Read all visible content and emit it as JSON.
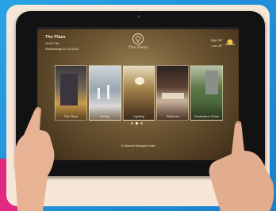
{
  "header": {
    "title": "The Plaza",
    "time": "10:00 PM",
    "date": "Wednesday 01.10.2010",
    "brand": "The Plaza",
    "weather": {
      "high_label": "High",
      "high_value": "30°",
      "low_label": "Low",
      "low_value": "28°",
      "icon": "sun-icon"
    }
  },
  "tiles": [
    {
      "label": "The Plaza"
    },
    {
      "label": "Dining"
    },
    {
      "label": "Lighting"
    },
    {
      "label": "Wellness"
    },
    {
      "label": "Destination Guide"
    }
  ],
  "pagination": {
    "count": 3,
    "active": 1
  },
  "footer": {
    "text": "A Fairmont Managed Hotel"
  }
}
